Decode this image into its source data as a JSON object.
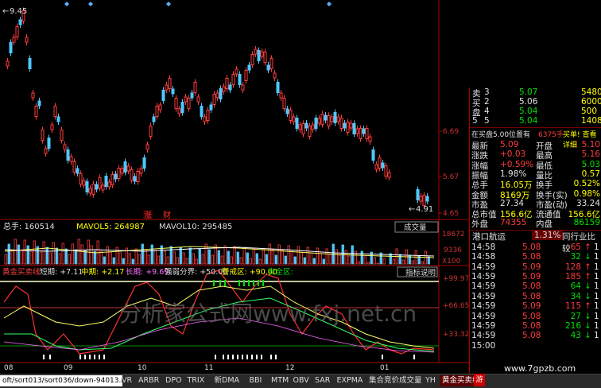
{
  "price_chart": {
    "high_label": "9.45",
    "low_label": "4.91",
    "right_axis": [
      "6.69",
      "5.67",
      "4.65"
    ],
    "badges": [
      "涨",
      "财"
    ]
  },
  "volume": {
    "header_total": "总手: 160514",
    "mavol5": "MAVOL5: 264987",
    "mavol10": "MAVOL10: 295485",
    "menu_label": "成交量",
    "axis": [
      "18672",
      "9336",
      "X100"
    ]
  },
  "indicator": {
    "name": "黄金买卖线",
    "short": "短期: +7.11",
    "mid": "中期: +2.17",
    "long": "长期: +9.69",
    "strong_weak": "强弱分界: +50.00",
    "warn": "警戒区: +90.00",
    "safe": "安全区:",
    "explain": "指标说明",
    "axis": [
      "+99.97",
      "+66.65",
      "+33.32"
    ],
    "watermark": "分析家公式网www.fxj.net.cn"
  },
  "dates": [
    "08",
    "09",
    "10",
    "11",
    "12",
    "01"
  ],
  "status_url": "oft/sort013/sort036/down-94013.html",
  "tabs": [
    "VR",
    "ARBR",
    "DPO",
    "TRIX",
    "新DMA",
    "BBI",
    "MTM",
    "OBV",
    "SAR",
    "EXPMA",
    "集合竞价成交量",
    "YH",
    "黄金买卖线"
  ],
  "quote": {
    "book": [
      {
        "label": "卖",
        "n": "3",
        "price": "5.07",
        "vol": "5480"
      },
      {
        "label": "买",
        "n": "2",
        "price": "5.06",
        "vol": "6000"
      },
      {
        "label": "盘",
        "n": "4",
        "price": "5.04",
        "vol": "500"
      },
      {
        "label": "5",
        "n": "5",
        "price": "5.04",
        "vol": "1408"
      }
    ],
    "notice_left": "在买盘5.00位置有",
    "notice_mid": "6375手",
    "notice_right": "买单! 查看详细",
    "stats": [
      {
        "l1": "最新",
        "v1": "5.09",
        "l2": "开盘",
        "v2": "5.10",
        "c1": "red",
        "c2": "red"
      },
      {
        "l1": "涨跌",
        "v1": "+0.03",
        "l2": "最高",
        "v2": "5.16",
        "c1": "red",
        "c2": "red"
      },
      {
        "l1": "涨幅",
        "v1": "+0.59%",
        "l2": "最低",
        "v2": "5.03",
        "c1": "red",
        "c2": "green"
      },
      {
        "l1": "振幅",
        "v1": "1.98%",
        "l2": "量比",
        "v2": "0.57",
        "c1": "white",
        "c2": "yellow"
      },
      {
        "l1": "总手",
        "v1": "16.05万",
        "l2": "换手",
        "v2": "0.52%",
        "c1": "yellow",
        "c2": "yellow"
      },
      {
        "l1": "金额",
        "v1": "8169万",
        "l2": "换手(实)",
        "v2": "0.98%",
        "c1": "yellow",
        "c2": "yellow"
      },
      {
        "l1": "市盈",
        "v1": "27.34",
        "l2": "市盈(动)",
        "v2": "33.24",
        "c1": "white",
        "c2": "white"
      },
      {
        "l1": "总市值",
        "v1": "156.6亿",
        "l2": "流通值",
        "v2": "156.6亿",
        "c1": "yellow",
        "c2": "yellow"
      },
      {
        "l1": "外盘",
        "v1": "74355",
        "l2": "内盘",
        "v2": "86159",
        "c1": "red",
        "c2": "green"
      }
    ],
    "sector_name": "港口航运",
    "sector_pct": "1.31%",
    "sector_link": "同行业比较",
    "ticks": [
      {
        "t": "14:58",
        "p": "5.08",
        "v": "65",
        "d": "up"
      },
      {
        "t": "14:58",
        "p": "5.08",
        "v": "32",
        "d": "down"
      },
      {
        "t": "14:59",
        "p": "5.09",
        "v": "128",
        "d": "up"
      },
      {
        "t": "14:59",
        "p": "5.09",
        "v": "185",
        "d": "up"
      },
      {
        "t": "14:59",
        "p": "5.08",
        "v": "64",
        "d": "down"
      },
      {
        "t": "14:59",
        "p": "5.08",
        "v": "34",
        "d": "down"
      },
      {
        "t": "14:59",
        "p": "5.09",
        "v": "115",
        "d": "up"
      },
      {
        "t": "14:59",
        "p": "5.08",
        "v": "27",
        "d": "down"
      },
      {
        "t": "14:59",
        "p": "5.08",
        "v": "216",
        "d": "down"
      },
      {
        "t": "14:59",
        "p": "5.08",
        "v": "43",
        "d": "down"
      },
      {
        "t": "15:00",
        "p": "",
        "v": "",
        "d": ""
      }
    ],
    "footer_url": "www.7gpzb.com"
  }
}
